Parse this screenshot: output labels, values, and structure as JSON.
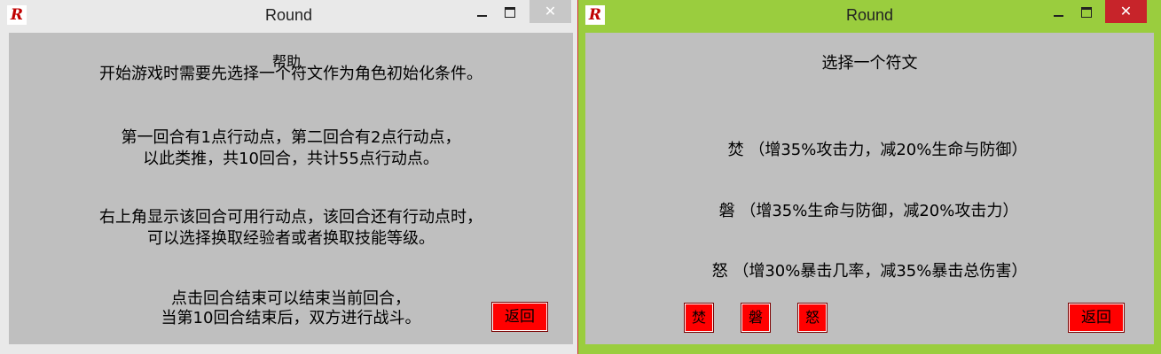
{
  "left_window": {
    "title": "Round",
    "icon": "R",
    "controls": {
      "minimize": "minimize-icon",
      "maximize": "maximize-icon",
      "close": "✕"
    },
    "heading": "帮助",
    "paragraphs": [
      [
        "开始游戏时需要先选择一个符文作为角色初始化条件。"
      ],
      [
        "第一回合有1点行动点，第二回合有2点行动点，",
        "以此类推，共10回合，共计55点行动点。"
      ],
      [
        "右上角显示该回合可用行动点，该回合还有行动点时，",
        "可以选择换取经验者或者换取技能等级。"
      ],
      [
        "点击回合结束可以结束当前回合，",
        "当第10回合结束后，双方进行战斗。"
      ]
    ],
    "back_button": "返回"
  },
  "right_window": {
    "title": "Round",
    "icon": "R",
    "controls": {
      "minimize": "minimize-icon",
      "maximize": "maximize-icon",
      "close": "✕"
    },
    "heading": "选择一个符文",
    "runes": [
      "焚 （增35%攻击力，减20%生命与防御）",
      "磐 （增35%生命与防御，减20%攻击力）",
      "怒 （增30%暴击几率，减35%暴击总伤害）"
    ],
    "rune_buttons": [
      "焚",
      "磐",
      "怒"
    ],
    "back_button": "返回"
  },
  "colors": {
    "active_frame": "#9acd3e",
    "inactive_frame": "#e9e9e9",
    "client_bg": "#bfbfbf",
    "button_red": "#ff0000",
    "close_red": "#c7242a"
  }
}
